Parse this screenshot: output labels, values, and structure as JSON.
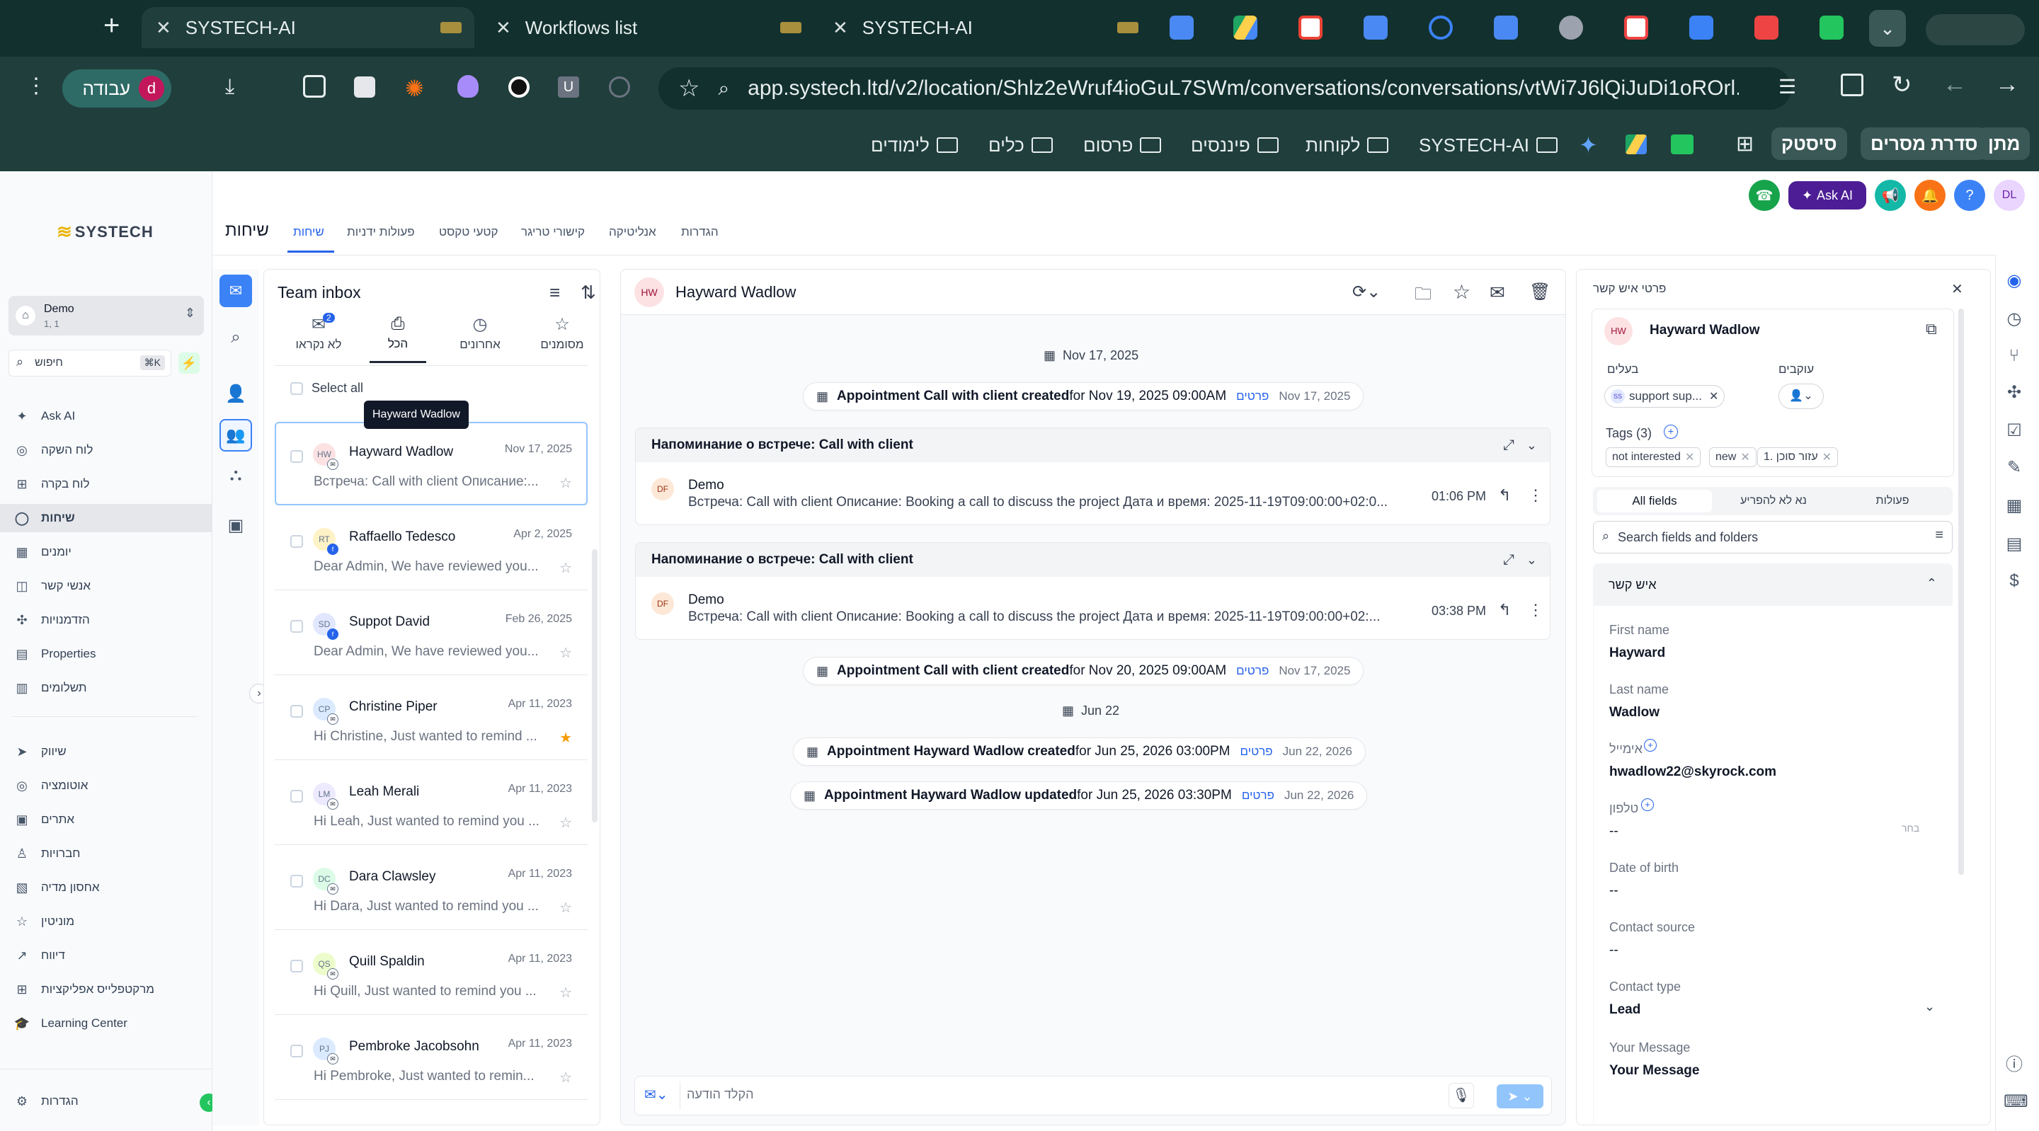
{
  "browser": {
    "tabs": [
      {
        "title": "SYSTECH-AI",
        "active": true
      },
      {
        "title": "Workflows list",
        "active": false
      },
      {
        "title": "SYSTECH-AI",
        "active": false
      }
    ],
    "new_tab": "+",
    "profile_label": "עבודה",
    "profile_initial": "d",
    "url": "app.systech.ltd/v2/location/Shlz2eWruf4ioGuL7SWm/conversations/conversations/vtWi7J6lQiJuDi1oROrl...",
    "bookmarks": [
      "לימודים",
      "כלים",
      "פרסום",
      "פיננסים",
      "לקוחות",
      "SYSTECH-AI"
    ],
    "bookmark_buttons": [
      "סיסטק",
      "סדרת מסרים",
      "מתן"
    ]
  },
  "app": {
    "logo_text": "SYSTECH",
    "location": {
      "name": "Demo",
      "sub": "1, 1"
    },
    "search_placeholder": "חיפוש",
    "search_shortcut": "⌘K",
    "nav": [
      {
        "label": "Ask AI",
        "icon": "sparkle-icon"
      },
      {
        "label": "לוח השקה",
        "icon": "launchpad-icon"
      },
      {
        "label": "לוח בקרה",
        "icon": "dashboard-icon"
      },
      {
        "label": "שיחות",
        "icon": "chat-icon",
        "active": true
      },
      {
        "label": "יומנים",
        "icon": "calendar-icon"
      },
      {
        "label": "אנשי קשר",
        "icon": "contacts-icon"
      },
      {
        "label": "הזדמנויות",
        "icon": "opportunities-icon"
      },
      {
        "label": "Properties",
        "icon": "properties-icon"
      },
      {
        "label": "תשלומים",
        "icon": "payments-icon"
      }
    ],
    "nav2": [
      {
        "label": "שיווק",
        "icon": "marketing-icon"
      },
      {
        "label": "אוטומציה",
        "icon": "automation-icon"
      },
      {
        "label": "אתרים",
        "icon": "sites-icon"
      },
      {
        "label": "חברויות",
        "icon": "memberships-icon"
      },
      {
        "label": "אחסון מדיה",
        "icon": "media-icon"
      },
      {
        "label": "מוניטין",
        "icon": "reputation-icon"
      },
      {
        "label": "דיווח",
        "icon": "reporting-icon"
      },
      {
        "label": "מרקטפלייס אפליקציות",
        "icon": "marketplace-icon"
      },
      {
        "label": "Learning Center",
        "icon": "learning-icon"
      }
    ],
    "settings_label": "הגדרות",
    "page_title": "שיחות",
    "tabs": [
      "שיחות",
      "פעולות ידניות",
      "קטעי טקסט",
      "קישורי טריגר",
      "אנליטיקה",
      "הגדרות"
    ],
    "top_actions": {
      "ask_ai": "Ask AI",
      "avatar": "DL",
      "help": "?"
    },
    "inbox": {
      "title": "Team inbox",
      "filters": [
        {
          "label": "לא נקראו",
          "count": "2"
        },
        {
          "label": "הכל"
        },
        {
          "label": "אחרונים"
        },
        {
          "label": "מסומנים"
        }
      ],
      "select_all": "Select all",
      "tooltip": "Hayward Wadlow",
      "conversations": [
        {
          "initials": "HW",
          "name": "Hayward Wadlow",
          "date": "Nov 17, 2025",
          "preview": "Встреча: Call with client Описание:...",
          "starred": false,
          "color": "#fde2e4"
        },
        {
          "initials": "RT",
          "name": "Raffaello Tedesco",
          "date": "Apr 2, 2025",
          "preview": "Dear Admin, We have reviewed you...",
          "starred": false,
          "color": "#fef3c7"
        },
        {
          "initials": "SD",
          "name": "Suppot David",
          "date": "Feb 26, 2025",
          "preview": "Dear Admin, We have reviewed you...",
          "starred": false,
          "color": "#e0e7ff"
        },
        {
          "initials": "CP",
          "name": "Christine Piper",
          "date": "Apr 11, 2023",
          "preview": "Hi Christine, Just wanted to remind ...",
          "starred": true,
          "color": "#dbeafe"
        },
        {
          "initials": "LM",
          "name": "Leah Merali",
          "date": "Apr 11, 2023",
          "preview": "Hi Leah, Just wanted to remind you ...",
          "starred": false,
          "color": "#ede9fe"
        },
        {
          "initials": "DC",
          "name": "Dara Clawsley",
          "date": "Apr 11, 2023",
          "preview": "Hi Dara, Just wanted to remind you ...",
          "starred": false,
          "color": "#dcfce7"
        },
        {
          "initials": "QS",
          "name": "Quill Spaldin",
          "date": "Apr 11, 2023",
          "preview": "Hi Quill, Just wanted to remind you ...",
          "starred": false,
          "color": "#ecfccb"
        },
        {
          "initials": "PJ",
          "name": "Pembroke Jacobsohn",
          "date": "Apr 11, 2023",
          "preview": "Hi Pembroke, Just wanted to remin...",
          "starred": false,
          "color": "#dbeafe"
        }
      ]
    },
    "thread": {
      "contact_initials": "HW",
      "contact_name": "Hayward Wadlow",
      "date1": "Nov 17, 2025",
      "event1": {
        "bold": "Appointment Call with client created",
        "rest": " for Nov 19, 2025 09:00AM",
        "link": "פרטים",
        "date": "Nov 17, 2025"
      },
      "card1": {
        "title": "Напоминание о встрече: Call with client",
        "sender": "Demo",
        "initials": "DF",
        "body": "Встреча: Call with client Описание: Booking a call to discuss the project Дата и время: 2025-11-19T09:00:00+02:0...",
        "time": "01:06 PM"
      },
      "card2": {
        "title": "Напоминание о встрече: Call with client",
        "sender": "Demo",
        "initials": "DF",
        "body": "Встреча: Call with client Описание: Booking a call to discuss the project Дата и время: 2025-11-19T09:00:00+02:...",
        "time": "03:38 PM"
      },
      "event2": {
        "bold": "Appointment Call with client created",
        "rest": " for Nov 20, 2025 09:00AM",
        "link": "פרטים",
        "date": "Nov 17, 2025"
      },
      "date2": "Jun 22",
      "event3": {
        "bold": "Appointment Hayward Wadlow created",
        "rest": " for Jun 25, 2026 03:00PM",
        "link": "פרטים",
        "date": "Jun 22, 2026"
      },
      "event4": {
        "bold": "Appointment Hayward Wadlow updated",
        "rest": " for Jun 25, 2026 03:30PM",
        "link": "פרטים",
        "date": "Jun 22, 2026"
      },
      "composer_placeholder": "הקלד הודעה"
    },
    "details": {
      "header": "פרטי איש קשר",
      "contact_initials": "HW",
      "contact_name": "Hayward Wadlow",
      "owners_label": "בעלים",
      "owner_initials": "SS",
      "owner_value": "support sup...",
      "followers_label": "עוקבים",
      "tags_label": "Tags (3)",
      "tags": [
        "not interested",
        "new",
        "1. עזור סוכן"
      ],
      "tabs": [
        "All fields",
        "נא לא להפריע",
        "פעולות"
      ],
      "search_placeholder": "Search fields and folders",
      "section": "איש קשר",
      "fields": [
        {
          "label": "First name",
          "value": "Hayward"
        },
        {
          "label": "Last name",
          "value": "Wadlow"
        },
        {
          "label": "אימייל",
          "value": "hwadlow22@skyrock.com"
        },
        {
          "label": "טלפון",
          "value": "--",
          "extra": "בחר"
        },
        {
          "label": "Date of birth",
          "value": "--"
        },
        {
          "label": "Contact source",
          "value": "--"
        },
        {
          "label": "Contact type",
          "value": "Lead"
        },
        {
          "label": "Your Message",
          "value": "Your Message"
        }
      ]
    }
  },
  "colors": {
    "brand_dark": "#12302d",
    "accent_blue": "#2563eb",
    "ai_purple": "#4c1d95",
    "call_green": "#16a34a"
  }
}
